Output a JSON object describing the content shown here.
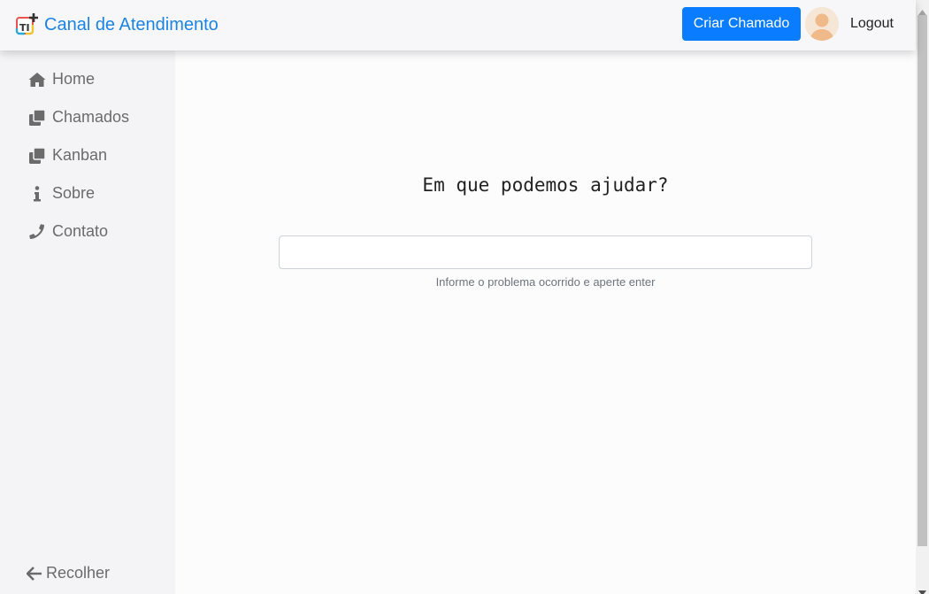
{
  "header": {
    "brand_title": "Canal de Atendimento",
    "create_button_label": "Criar Chamado",
    "logout_label": "Logout"
  },
  "sidebar": {
    "items": [
      {
        "label": "Home",
        "icon": "home-icon"
      },
      {
        "label": "Chamados",
        "icon": "clone-icon"
      },
      {
        "label": "Kanban",
        "icon": "clone-icon"
      },
      {
        "label": "Sobre",
        "icon": "info-icon"
      },
      {
        "label": "Contato",
        "icon": "phone-icon"
      }
    ],
    "collapse_label": "Recolher"
  },
  "main": {
    "heading": "Em que podemos ajudar?",
    "search_value": "",
    "hint": "Informe o problema ocorrido e aperte enter"
  },
  "colors": {
    "brand": "#1a84e6",
    "primary_button": "#0a7cff",
    "nav_text": "#6b6b6b"
  }
}
